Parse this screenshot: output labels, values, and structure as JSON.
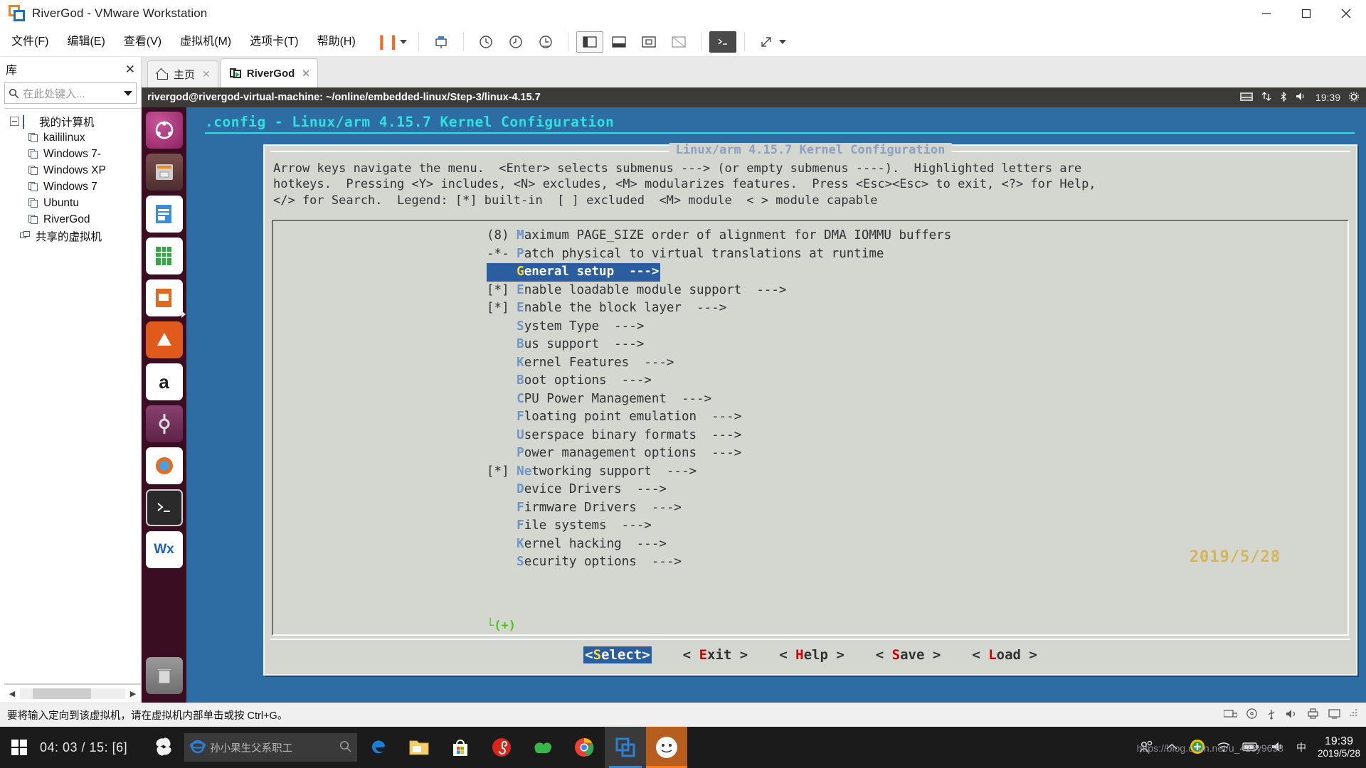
{
  "window": {
    "title": "RiverGod - VMware Workstation",
    "minimize_label": "—",
    "maximize_label": "❐",
    "close_label": "✕"
  },
  "menubar": {
    "items": [
      {
        "label": "文件(F)",
        "name": "menu-file"
      },
      {
        "label": "编辑(E)",
        "name": "menu-edit"
      },
      {
        "label": "查看(V)",
        "name": "menu-view"
      },
      {
        "label": "虚拟机(M)",
        "name": "menu-vm"
      },
      {
        "label": "选项卡(T)",
        "name": "menu-tabs"
      },
      {
        "label": "帮助(H)",
        "name": "menu-help"
      }
    ],
    "pause_label": "❙❙",
    "dropdown_label": "▾"
  },
  "library": {
    "title": "库",
    "close_label": "✕",
    "search_placeholder": "在此处键入...",
    "root": "我的计算机",
    "vms": [
      "kaililinux",
      "Windows 7-",
      "Windows XP",
      "Windows 7",
      "Ubuntu",
      "RiverGod"
    ],
    "shared": "共享的虚拟机"
  },
  "tabs": [
    {
      "label": "主页",
      "icon": "home-icon",
      "active": false,
      "close": "✕"
    },
    {
      "label": "RiverGod",
      "icon": "vm-icon",
      "active": true,
      "close": "✕"
    }
  ],
  "guest": {
    "titlebar": "rivergod@rivergod-virtual-machine: ~/online/embedded-linux/Step-3/linux-4.15.7",
    "tray_time": "19:39",
    "terminal_title": ".config - Linux/arm 4.15.7 Kernel Configuration"
  },
  "menuconfig": {
    "legend_title": "Linux/arm 4.15.7 Kernel Configuration",
    "help_text": "Arrow keys navigate the menu.  <Enter> selects submenus ---> (or empty submenus ----).  Highlighted letters are\nhotkeys.  Pressing <Y> includes, <N> excludes, <M> modularizes features.  Press <Esc><Esc> to exit, <?> for Help,\n</> for Search.  Legend: [*] built-in  [ ] excluded  <M> module  < > module capable",
    "scroll_marker": "└(+)",
    "items": [
      {
        "prefix": "(8) ",
        "hotkey": "M",
        "rest": "aximum PAGE_SIZE order of alignment for DMA IOMMU buffers",
        "selected": false
      },
      {
        "prefix": "-*- ",
        "hotkey": "P",
        "rest": "atch physical to virtual translations at runtime",
        "selected": false
      },
      {
        "prefix": "    ",
        "hotkey": "G",
        "rest": "eneral setup  --->",
        "selected": true
      },
      {
        "prefix": "[*] ",
        "hotkey": "E",
        "rest": "nable loadable module support  --->",
        "selected": false
      },
      {
        "prefix": "[*] ",
        "hotkey": "E",
        "rest": "nable the block layer  --->",
        "selected": false
      },
      {
        "prefix": "    ",
        "hotkey": "S",
        "rest": "ystem Type  --->",
        "selected": false
      },
      {
        "prefix": "    ",
        "hotkey": "B",
        "rest": "us support  --->",
        "selected": false
      },
      {
        "prefix": "    ",
        "hotkey": "K",
        "rest": "ernel Features  --->",
        "selected": false
      },
      {
        "prefix": "    ",
        "hotkey": "B",
        "rest": "oot options  --->",
        "selected": false
      },
      {
        "prefix": "    ",
        "hotkey": "C",
        "rest": "PU Power Management  --->",
        "selected": false
      },
      {
        "prefix": "    ",
        "hotkey": "F",
        "rest": "loating point emulation  --->",
        "selected": false
      },
      {
        "prefix": "    ",
        "hotkey": "U",
        "rest": "serspace binary formats  --->",
        "selected": false
      },
      {
        "prefix": "    ",
        "hotkey": "P",
        "rest": "ower management options  --->",
        "selected": false
      },
      {
        "prefix": "[*] ",
        "hotkey": "Ne",
        "rest": "tworking support  --->",
        "selected": false
      },
      {
        "prefix": "    ",
        "hotkey": "D",
        "rest": "evice Drivers  --->",
        "selected": false
      },
      {
        "prefix": "    ",
        "hotkey": "F",
        "rest": "irmware Drivers  --->",
        "selected": false
      },
      {
        "prefix": "    ",
        "hotkey": "F",
        "rest": "ile systems  --->",
        "selected": false
      },
      {
        "prefix": "    ",
        "hotkey": "K",
        "rest": "ernel hacking  --->",
        "selected": false
      },
      {
        "prefix": "    ",
        "hotkey": "S",
        "rest": "ecurity options  --->",
        "selected": false
      }
    ],
    "buttons": [
      {
        "pre": "<",
        "hot": "S",
        "post": "elect>",
        "selected": true
      },
      {
        "pre": "< ",
        "hot": "E",
        "post": "xit >",
        "selected": false
      },
      {
        "pre": "< ",
        "hot": "H",
        "post": "elp >",
        "selected": false
      },
      {
        "pre": "< ",
        "hot": "S",
        "post": "ave >",
        "selected": false
      },
      {
        "pre": "< ",
        "hot": "L",
        "post": "oad >",
        "selected": false
      }
    ]
  },
  "statusbar": {
    "text": "要将输入定向到该虚拟机，请在虚拟机内部单击或按 Ctrl+G。"
  },
  "taskbar": {
    "clock_inline": "04: 03 / 15: [6]",
    "search_placeholder": "孙小果生父系职工",
    "ime_label": "中",
    "clock_time": "19:39",
    "clock_date": "2019/5/28"
  },
  "watermark": {
    "url": "https://blog.csdn.net/u_423y9698",
    "date": "2019/5/28"
  },
  "colors": {
    "accent": "#2b5ea0",
    "terminal_bg": "#2e6da4",
    "dialog_bg": "#d3d7cf",
    "hotkey": "#6f94c6",
    "hotkey_selected": "#ffd83b",
    "button_hotkey": "#cc0000",
    "title_cyan": "#33e0e0"
  }
}
